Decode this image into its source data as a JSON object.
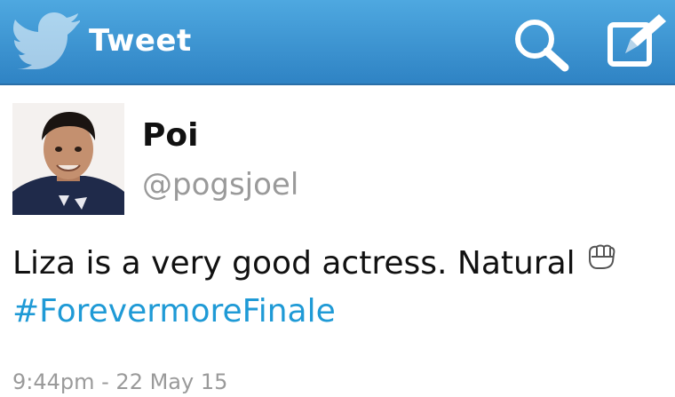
{
  "header": {
    "title": "Tweet",
    "icons": {
      "logo": "twitter-bird-icon",
      "search": "search-icon",
      "compose": "compose-icon"
    },
    "bar_color": "#3a92d2"
  },
  "tweet": {
    "display_name": "Poi",
    "handle": "@pogsjoel",
    "text": "Liza is a very good actress. Natural",
    "emoji": "fist-emoji-icon",
    "hashtag": "#ForevermoreFinale",
    "timestamp": "9:44pm - 22 May 15",
    "hashtag_color": "#1f9ad6"
  }
}
